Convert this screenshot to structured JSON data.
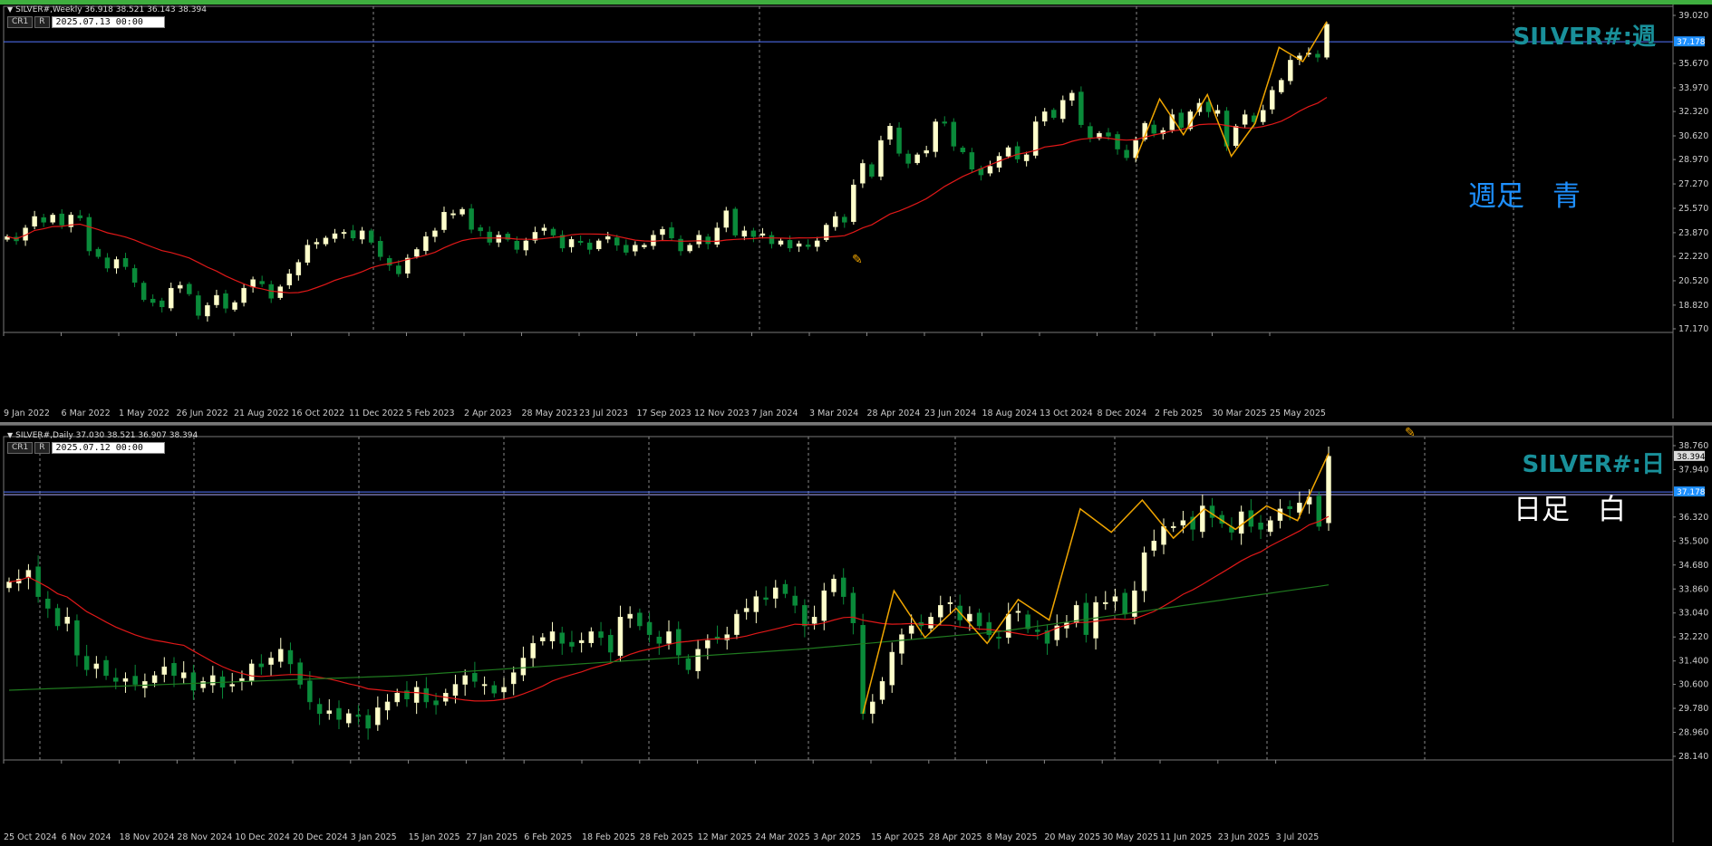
{
  "weekly": {
    "header": "SILVER#,Weekly  36.918 38.521 36.143 38.394",
    "ctl_cr": "CR1",
    "ctl_r": "R",
    "datetime": "2025.07.13 00:00",
    "symbol_label": "SILVER#:週",
    "note": "週足　青",
    "note_color": "#1e90ff"
  },
  "daily": {
    "header": "SILVER#,Daily  37.030 38.521 36.907 38.394",
    "ctl_cr": "CR1",
    "ctl_r": "R",
    "datetime": "2025.07.12 00:00",
    "symbol_label": "SILVER#:日",
    "note": "日足　白",
    "note_color": "#ffffff"
  },
  "colors": {
    "bull": "#ffffcc",
    "bear": "#0a8a3a",
    "ma_red": "#e01818",
    "ma_green": "#1f7a1f",
    "zigzag": "#f0a500",
    "hline": "#5577ff",
    "label_accent": "#19909a",
    "price_tag_bg": "#1e90ff",
    "frame_top": "#3fae3f"
  },
  "chart_data": [
    {
      "type": "candlestick",
      "title": "SILVER#,Weekly",
      "ylim": [
        17.17,
        39.02
      ],
      "y_ticks": [
        39.02,
        37.178,
        35.67,
        33.97,
        32.32,
        30.62,
        28.97,
        27.27,
        25.57,
        23.87,
        22.22,
        20.52,
        18.82,
        17.17
      ],
      "current_price": 38.394,
      "hline": 37.178,
      "x_labels": [
        "9 Jan 2022",
        "6 Mar 2022",
        "1 May 2022",
        "26 Jun 2022",
        "21 Aug 2022",
        "16 Oct 2022",
        "11 Dec 2022",
        "5 Feb 2023",
        "2 Apr 2023",
        "28 May 2023",
        "23 Jul 2023",
        "17 Sep 2023",
        "12 Nov 2023",
        "7 Jan 2024",
        "3 Mar 2024",
        "28 Apr 2024",
        "23 Jun 2024",
        "18 Aug 2024",
        "13 Oct 2024",
        "8 Dec 2024",
        "2 Feb 2025",
        "30 Mar 2025",
        "25 May 2025"
      ],
      "closes": [
        23.6,
        23.3,
        24.2,
        25.0,
        24.6,
        25.1,
        24.4,
        25.1,
        24.9,
        22.6,
        22.2,
        21.4,
        22.0,
        21.5,
        20.4,
        19.2,
        19.0,
        18.7,
        20.0,
        20.2,
        19.6,
        18.1,
        18.8,
        19.5,
        18.6,
        19.0,
        20.0,
        20.6,
        20.3,
        19.3,
        20.1,
        21.0,
        21.8,
        23.0,
        23.2,
        23.5,
        23.8,
        23.9,
        23.5,
        24.0,
        23.2,
        22.2,
        21.6,
        21.0,
        22.1,
        22.7,
        23.6,
        24.0,
        25.3,
        25.2,
        25.5,
        24.1,
        24.0,
        23.2,
        23.7,
        23.4,
        22.7,
        23.3,
        23.9,
        24.2,
        23.7,
        22.8,
        23.4,
        23.2,
        22.7,
        23.3,
        23.6,
        23.0,
        22.5,
        23.0,
        23.0,
        23.7,
        24.1,
        23.5,
        22.6,
        23.0,
        23.7,
        23.1,
        24.2,
        25.4,
        23.7,
        24.0,
        23.6,
        23.8,
        23.1,
        23.3,
        22.8,
        23.1,
        22.9,
        23.3,
        24.4,
        25.0,
        24.6,
        27.2,
        28.7,
        27.8,
        30.3,
        31.3,
        29.4,
        28.7,
        29.3,
        29.6,
        31.6,
        31.5,
        29.9,
        29.5,
        28.3,
        27.9,
        28.5,
        29.2,
        29.8,
        29.0,
        29.3,
        31.6,
        32.3,
        31.9,
        33.1,
        33.6,
        31.4,
        30.5,
        30.8,
        30.6,
        29.7,
        29.1,
        30.3,
        31.5,
        30.8,
        31.0,
        32.1,
        31.2,
        32.3,
        32.9,
        32.3,
        32.4,
        29.9,
        31.3,
        32.1,
        31.6,
        32.4,
        33.8,
        34.5,
        35.9,
        36.2,
        36.4,
        36.1,
        38.4
      ],
      "ma_red": {
        "start": 23.9,
        "mid_low": 18.8,
        "end": 33.9
      },
      "zigzag_ends": [
        29.0,
        33.2,
        30.7,
        33.5,
        29.2,
        31.5,
        36.8,
        35.8,
        38.6
      ]
    },
    {
      "type": "candlestick",
      "title": "SILVER#,Daily",
      "ylim": [
        28.14,
        38.76
      ],
      "y_ticks": [
        38.76,
        38.394,
        37.94,
        37.178,
        36.32,
        35.5,
        34.68,
        33.86,
        33.04,
        32.22,
        31.4,
        30.6,
        29.78,
        28.96,
        28.14
      ],
      "current_price": 38.394,
      "hline": 37.178,
      "x_labels": [
        "25 Oct 2024",
        "6 Nov 2024",
        "18 Nov 2024",
        "28 Nov 2024",
        "10 Dec 2024",
        "20 Dec 2024",
        "3 Jan 2025",
        "15 Jan 2025",
        "27 Jan 2025",
        "6 Feb 2025",
        "18 Feb 2025",
        "28 Feb 2025",
        "12 Mar 2025",
        "24 Mar 2025",
        "3 Apr 2025",
        "15 Apr 2025",
        "28 Apr 2025",
        "8 May 2025",
        "20 May 2025",
        "30 May 2025",
        "11 Jun 2025",
        "23 Jun 2025",
        "3 Jul 2025"
      ],
      "closes": [
        34.1,
        34.2,
        34.5,
        33.6,
        33.2,
        32.6,
        32.9,
        31.6,
        31.1,
        31.3,
        30.9,
        30.7,
        30.8,
        30.6,
        30.7,
        30.9,
        31.2,
        30.9,
        31.0,
        30.4,
        30.7,
        30.9,
        30.5,
        30.6,
        30.8,
        31.3,
        31.2,
        31.5,
        31.8,
        31.3,
        30.6,
        30.0,
        29.6,
        29.7,
        29.4,
        29.6,
        29.5,
        29.1,
        29.8,
        30.0,
        30.3,
        30.1,
        30.5,
        30.0,
        29.9,
        30.3,
        30.6,
        30.9,
        30.7,
        30.6,
        30.3,
        30.5,
        31.0,
        31.5,
        32.0,
        32.2,
        32.4,
        32.0,
        31.9,
        32.1,
        32.4,
        32.2,
        31.7,
        32.9,
        33.0,
        32.6,
        32.3,
        32.0,
        32.4,
        31.6,
        31.1,
        31.8,
        32.1,
        32.2,
        32.3,
        33.0,
        33.2,
        33.6,
        33.5,
        33.9,
        33.7,
        33.3,
        32.6,
        32.9,
        33.8,
        34.2,
        33.6,
        32.7,
        29.6,
        30.0,
        30.7,
        31.7,
        32.3,
        32.6,
        32.6,
        32.9,
        33.3,
        33.4,
        32.8,
        33.0,
        32.6,
        32.3,
        32.2,
        33.0,
        33.1,
        32.5,
        32.4,
        32.0,
        32.6,
        32.7,
        33.3,
        32.3,
        33.4,
        33.4,
        33.6,
        33.0,
        33.8,
        35.1,
        35.5,
        36.0,
        36.0,
        36.2,
        35.9,
        36.7,
        36.3,
        36.1,
        35.8,
        36.5,
        36.0,
        35.9,
        36.2,
        36.6,
        36.6,
        36.8,
        37.0,
        36.0,
        38.4
      ],
      "ma_red": {
        "start": 32.2,
        "peak": 33.2,
        "end": 36.7
      },
      "ma_green": {
        "start": 30.4,
        "end": 34.0
      },
      "zigzag_ends": [
        29.6,
        33.8,
        32.2,
        33.2,
        32.0,
        33.5,
        32.8,
        36.6,
        35.8,
        36.9,
        35.6,
        36.6,
        35.9,
        36.7,
        36.2,
        38.5
      ]
    }
  ]
}
